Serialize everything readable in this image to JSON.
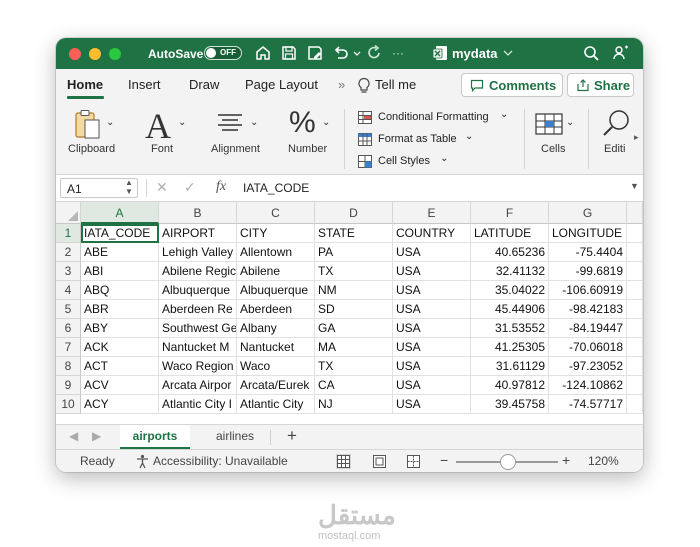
{
  "titlebar": {
    "autosave_label": "AutoSave",
    "autosave_state": "OFF",
    "doc_name": "mydata",
    "icons": [
      "home-icon",
      "save-icon",
      "save-as-icon",
      "undo-icon",
      "redo-icon",
      "word-doc-icon",
      "search-icon",
      "share-people-icon"
    ]
  },
  "ribbon_tabs": {
    "items": [
      "Home",
      "Insert",
      "Draw",
      "Page Layout"
    ],
    "tell_me": "Tell me",
    "comments": "Comments",
    "share": "Share"
  },
  "ribbon": {
    "clipboard": "Clipboard",
    "font": "Font",
    "alignment": "Alignment",
    "number": "Number",
    "conditional_formatting": "Conditional Formatting",
    "format_as_table": "Format as Table",
    "cell_styles": "Cell Styles",
    "cells": "Cells",
    "editing": "Editi"
  },
  "formula_bar": {
    "name_box": "A1",
    "fx": "fx",
    "value": "IATA_CODE"
  },
  "grid": {
    "columns": [
      "A",
      "B",
      "C",
      "D",
      "E",
      "F",
      "G"
    ],
    "rows": [
      {
        "n": "1",
        "cells": [
          "IATA_CODE",
          "AIRPORT",
          "CITY",
          "STATE",
          "COUNTRY",
          "LATITUDE",
          "LONGITUDE"
        ]
      },
      {
        "n": "2",
        "cells": [
          "ABE",
          "Lehigh Valley",
          "Allentown",
          "PA",
          "USA",
          "40.65236",
          "-75.4404"
        ]
      },
      {
        "n": "3",
        "cells": [
          "ABI",
          "Abilene Regic",
          "Abilene",
          "TX",
          "USA",
          "32.41132",
          "-99.6819"
        ]
      },
      {
        "n": "4",
        "cells": [
          "ABQ",
          "Albuquerque",
          "Albuquerque",
          "NM",
          "USA",
          "35.04022",
          "-106.60919"
        ]
      },
      {
        "n": "5",
        "cells": [
          "ABR",
          "Aberdeen Re",
          "Aberdeen",
          "SD",
          "USA",
          "45.44906",
          "-98.42183"
        ]
      },
      {
        "n": "6",
        "cells": [
          "ABY",
          "Southwest Ge",
          "Albany",
          "GA",
          "USA",
          "31.53552",
          "-84.19447"
        ]
      },
      {
        "n": "7",
        "cells": [
          "ACK",
          "Nantucket M",
          "Nantucket",
          "MA",
          "USA",
          "41.25305",
          "-70.06018"
        ]
      },
      {
        "n": "8",
        "cells": [
          "ACT",
          "Waco Region",
          "Waco",
          "TX",
          "USA",
          "31.61129",
          "-97.23052"
        ]
      },
      {
        "n": "9",
        "cells": [
          "ACV",
          "Arcata Airpor",
          "Arcata/Eurek",
          "CA",
          "USA",
          "40.97812",
          "-124.10862"
        ]
      },
      {
        "n": "10",
        "cells": [
          "ACY",
          "Atlantic City I",
          "Atlantic City",
          "NJ",
          "USA",
          "39.45758",
          "-74.57717"
        ]
      }
    ]
  },
  "sheets": {
    "tabs": [
      "airports",
      "airlines"
    ],
    "add": "+"
  },
  "status": {
    "ready": "Ready",
    "accessibility": "Accessibility: Unavailable",
    "zoom_minus": "−",
    "zoom_plus": "+",
    "zoom": "120%"
  },
  "watermark": {
    "logo": "مستقل",
    "text": "mostaql.com"
  },
  "colors": {
    "brand_green": "#1f7244",
    "close": "#ff5f57",
    "minimize": "#febc2e",
    "zoom": "#28c840"
  }
}
